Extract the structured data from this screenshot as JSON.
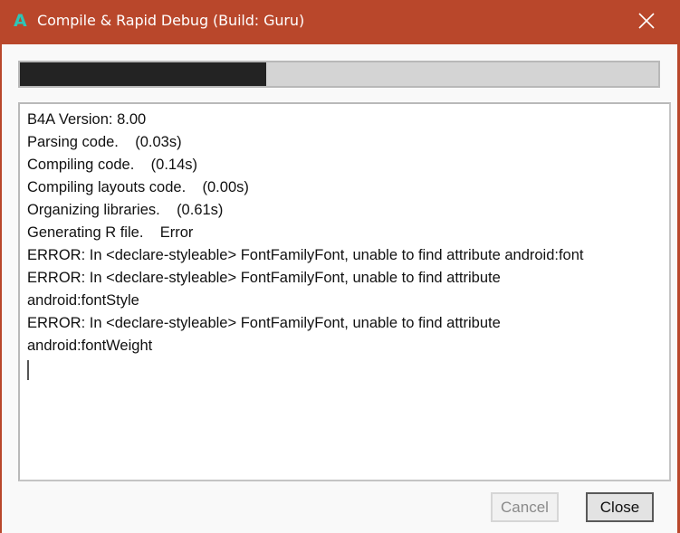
{
  "window": {
    "title": "Compile & Rapid Debug (Build: Guru)",
    "app_icon": "b4a-logo-icon",
    "app_icon_glyph": "A",
    "close_icon": "close-icon",
    "accent_color": "#b9472b",
    "icon_color": "#2ec4b6"
  },
  "progress": {
    "value_percent": 38.6,
    "fill_color": "#232323",
    "track_color": "#d4d4d4"
  },
  "log": {
    "lines": [
      "B4A Version: 8.00",
      "Parsing code.    (0.03s)",
      "Compiling code.    (0.14s)",
      "Compiling layouts code.    (0.00s)",
      "Organizing libraries.    (0.61s)",
      "Generating R file.    Error",
      "ERROR: In <declare-styleable> FontFamilyFont, unable to find attribute android:font",
      "ERROR: In <declare-styleable> FontFamilyFont, unable to find attribute",
      "android:fontStyle",
      "ERROR: In <declare-styleable> FontFamilyFont, unable to find attribute",
      "android:fontWeight"
    ]
  },
  "buttons": {
    "cancel_label": "Cancel",
    "cancel_enabled": false,
    "close_label": "Close"
  }
}
